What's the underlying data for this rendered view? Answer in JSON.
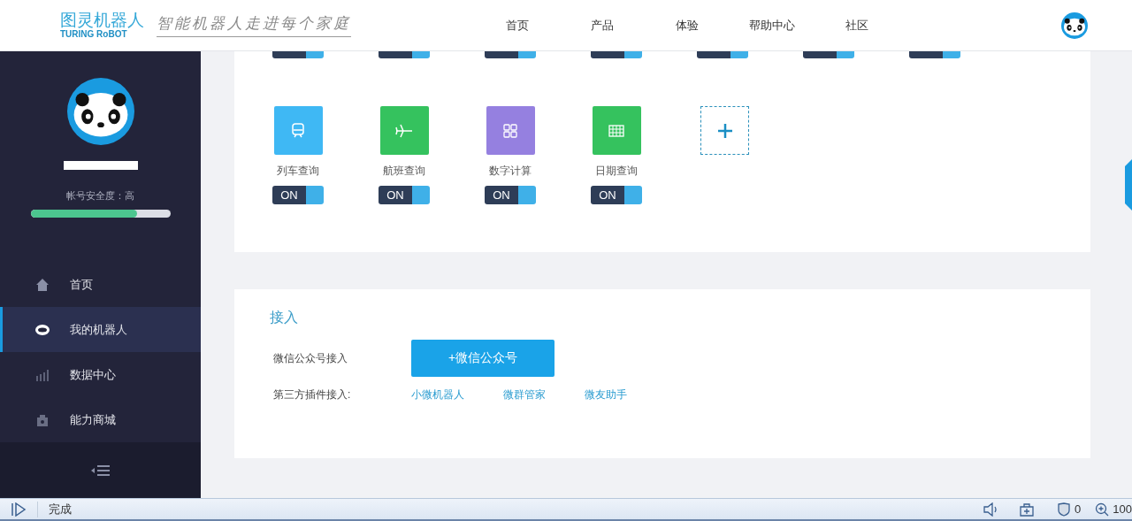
{
  "header": {
    "logo_text": "图灵机器人",
    "logo_subtitle": "TURING RoBOT",
    "slogan": "智能机器人走进每个家庭",
    "nav": [
      {
        "label": "首页",
        "selected": false
      },
      {
        "label": "产品",
        "selected": false
      },
      {
        "label": "体验",
        "selected": false
      },
      {
        "label": "帮助中心",
        "selected": false
      },
      {
        "label": "社区",
        "selected": false
      }
    ]
  },
  "sidebar": {
    "security_label": "帐号安全度：高",
    "security": {
      "level": 0.76
    },
    "items": [
      {
        "label": "首页",
        "selected": false
      },
      {
        "label": "我的机器人",
        "selected": true
      },
      {
        "label": "数据中心",
        "selected": false
      },
      {
        "label": "能力商城",
        "selected": false
      }
    ]
  },
  "skills": {
    "partial_row": [
      {
        "on": true
      },
      {
        "on": true
      },
      {
        "on": true
      },
      {
        "on": true
      },
      {
        "on": true
      },
      {
        "on": true
      },
      {
        "on": true
      }
    ],
    "items": [
      {
        "name": "列车查询",
        "color": "#3fb8f4",
        "toggle": "ON",
        "on": true
      },
      {
        "name": "航班查询",
        "color": "#35c25e",
        "toggle": "ON",
        "on": true
      },
      {
        "name": "数字计算",
        "color": "#9580e0",
        "toggle": "ON",
        "on": true
      },
      {
        "name": "日期查询",
        "color": "#35c25e",
        "toggle": "ON",
        "on": true
      }
    ]
  },
  "access": {
    "title": "接入",
    "rows": [
      {
        "label": "微信公众号接入",
        "kind": "button",
        "items": [
          "+微信公众号"
        ]
      },
      {
        "label": "第三方插件接入:",
        "kind": "links",
        "items": [
          "小微机器人",
          "微群管家",
          "微友助手"
        ]
      }
    ]
  },
  "status_bar": {
    "status": "完成",
    "blocked": "0",
    "zoom": "100"
  }
}
